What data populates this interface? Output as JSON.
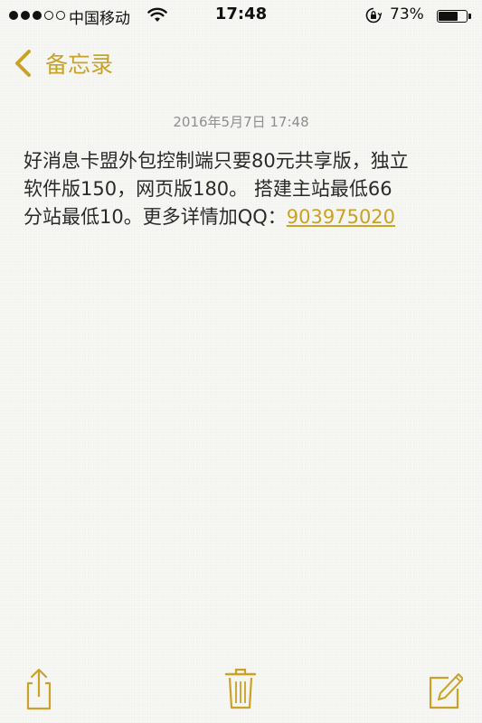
{
  "status_bar": {
    "carrier": "中国移动",
    "time": "17:48",
    "battery_percent_text": "73%",
    "battery_level": 0.73,
    "signal_strength": 3,
    "signal_max": 5
  },
  "nav": {
    "back_label": "备忘录"
  },
  "note": {
    "date": "2016年5月7日 17:48",
    "lines": [
      "好消息卡盟外包控制端只要80元共享版，独立",
      "软件版150，网页版180。 搭建主站最低66",
      "分站最低10。更多详情加QQ："
    ],
    "link": "903975020"
  },
  "toolbar": {
    "share_icon": "share-icon",
    "trash_icon": "trash-icon",
    "compose_icon": "compose-icon"
  },
  "colors": {
    "accent": "#c9a227",
    "background": "#f7f7f4",
    "text": "#2a2a2a",
    "date_text": "#8e8e8e"
  }
}
